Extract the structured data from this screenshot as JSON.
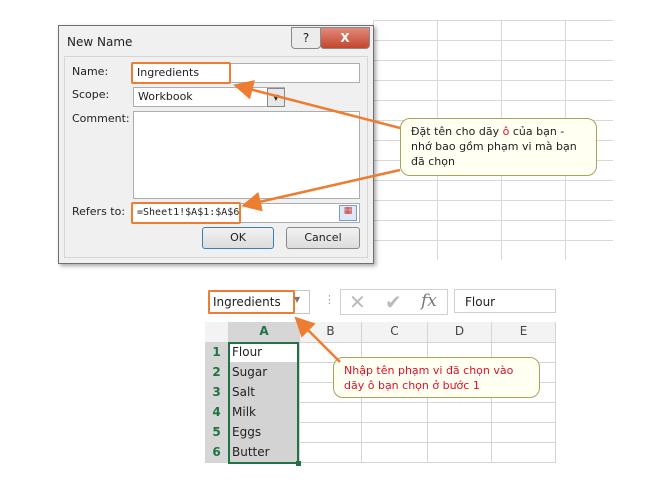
{
  "dialog": {
    "title": "New Name",
    "help_icon": "?",
    "close_icon": "X",
    "name_label": "Name:",
    "name_value": "Ingredients",
    "scope_label": "Scope:",
    "scope_value": "Workbook",
    "comment_label": "Comment:",
    "comment_value": "",
    "refers_label": "Refers to:",
    "refers_value": "=Sheet1!$A$1:$A$6",
    "ok": "OK",
    "cancel": "Cancel"
  },
  "callout1": {
    "pre": "Đặt tên cho dãy ",
    "highlight": "ô",
    "post": " của bạn - nhớ bao gồm phạm vi mà bạn đã chọn"
  },
  "callout2": {
    "text": "Nhập tên phạm vi đã chọn vào dãy ô bạn chọn ở bước 1"
  },
  "sheet": {
    "name_box": "Ingredients",
    "formula_value": "Flour",
    "fx": "fx",
    "columns": [
      "A",
      "B",
      "C",
      "D",
      "E"
    ],
    "rows": [
      {
        "n": "1",
        "a": "Flour"
      },
      {
        "n": "2",
        "a": "Sugar"
      },
      {
        "n": "3",
        "a": "Salt"
      },
      {
        "n": "4",
        "a": "Milk"
      },
      {
        "n": "5",
        "a": "Eggs"
      },
      {
        "n": "6",
        "a": "Butter"
      }
    ]
  },
  "colors": {
    "accent": "#ed7d31",
    "excel_green": "#217346",
    "callout_red": "#e0102a"
  }
}
